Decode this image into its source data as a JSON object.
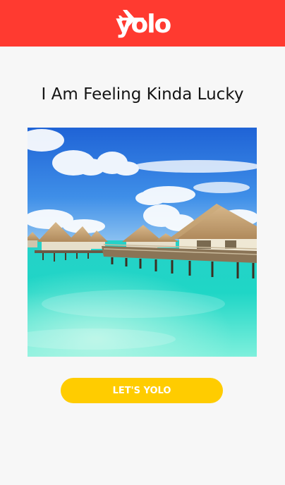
{
  "header": {
    "logo_text": "yolo",
    "logo_icon": "airplane-icon",
    "background_color": "#ff3a30"
  },
  "main": {
    "title": "I Am Feeling Kinda Lucky",
    "photo_subject": "overwater bungalows over turquoise lagoon",
    "cta_label": "LET'S YOLO",
    "cta_color": "#ffcc00"
  }
}
